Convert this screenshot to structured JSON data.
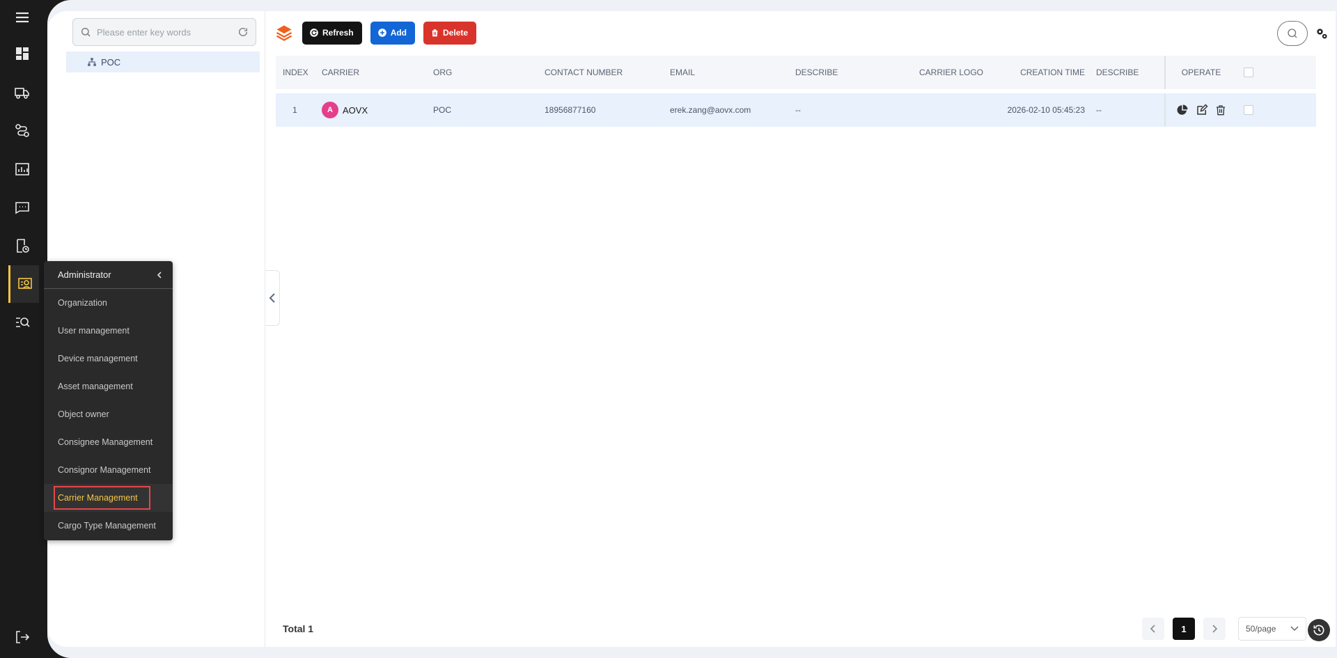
{
  "rail": {
    "items": [
      {
        "name": "menu-icon"
      },
      {
        "name": "dashboard-icon"
      },
      {
        "name": "truck-icon"
      },
      {
        "name": "route-icon"
      },
      {
        "name": "report-icon"
      },
      {
        "name": "chat-icon"
      },
      {
        "name": "clock-doc-icon"
      },
      {
        "name": "admin-icon"
      },
      {
        "name": "search-list-icon"
      }
    ],
    "accent": "#f5c542"
  },
  "sidebar_menu": {
    "title": "Administrator",
    "items": [
      {
        "label": "Organization"
      },
      {
        "label": "User management"
      },
      {
        "label": "Device management"
      },
      {
        "label": "Asset management"
      },
      {
        "label": "Object owner"
      },
      {
        "label": "Consignee Management"
      },
      {
        "label": "Consignor Management"
      },
      {
        "label": "Carrier Management"
      },
      {
        "label": "Cargo Type Management"
      }
    ],
    "active_item": "Carrier Management"
  },
  "tree": {
    "search_placeholder": "Please enter key words",
    "root_label": "POC"
  },
  "toolbar": {
    "refresh_label": "Refresh",
    "add_label": "Add",
    "delete_label": "Delete",
    "colors": {
      "refresh": "#141414",
      "add": "#1366d6",
      "delete": "#d9342b",
      "layers": "#f0611b"
    }
  },
  "table": {
    "headers": {
      "index": "INDEX",
      "carrier": "CARRIER",
      "org": "ORG",
      "contact": "CONTACT NUMBER",
      "email": "EMAIL",
      "describe": "DESCRIBE",
      "logo": "CARRIER LOGO",
      "time": "CREATION TIME",
      "describe2": "DESCRIBE",
      "operate": "OPERATE"
    },
    "rows": [
      {
        "index": "1",
        "avatar": "A",
        "carrier": "AOVX",
        "org": "POC",
        "contact": "18956877160",
        "email": "erek.zang@aovx.com",
        "describe": "--",
        "logo": "",
        "time": "2026-02-10 05:45:23",
        "describe2": "--"
      }
    ]
  },
  "footer": {
    "total": "Total 1",
    "current_page": "1",
    "page_size": "50/page"
  }
}
